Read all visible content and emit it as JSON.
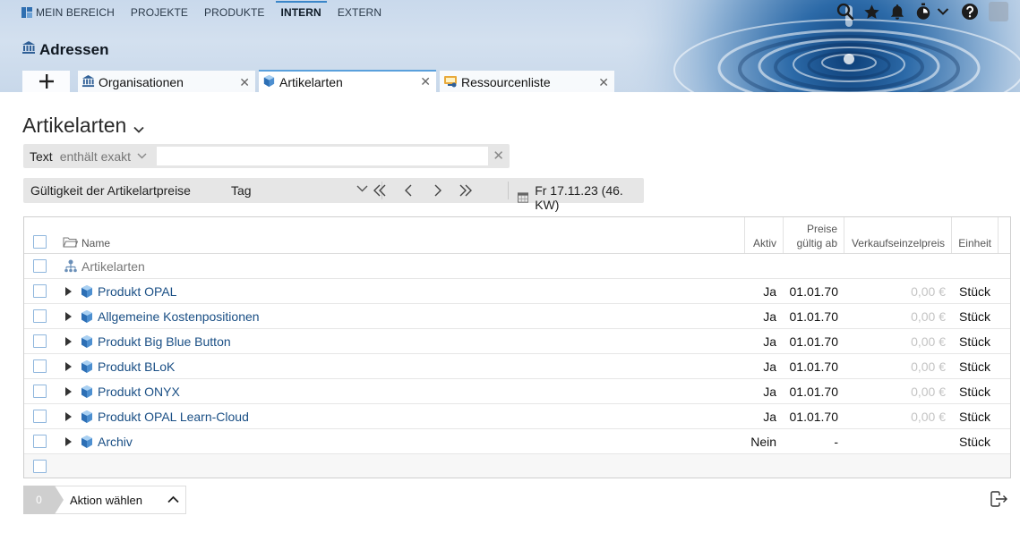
{
  "topnav": {
    "items": [
      {
        "label": "MEIN BEREICH"
      },
      {
        "label": "PROJEKTE"
      },
      {
        "label": "PRODUKTE"
      },
      {
        "label": "INTERN"
      },
      {
        "label": "EXTERN"
      }
    ],
    "active": "INTERN"
  },
  "tools": [
    "search-icon",
    "star-icon",
    "bell-icon",
    "stopwatch-icon",
    "chevron-down-icon",
    "help-icon",
    "user-avatar"
  ],
  "page": {
    "title": "Adressen"
  },
  "tabs": [
    {
      "label": "Organisationen",
      "icon": "building-icon"
    },
    {
      "label": "Artikelarten",
      "icon": "cube-icon",
      "active": true
    },
    {
      "label": "Ressourcenliste",
      "icon": "resource-icon"
    }
  ],
  "view": {
    "title": "Artikelarten"
  },
  "filter": {
    "field": "Text",
    "operator": "enthält exakt",
    "value": ""
  },
  "validity": {
    "label": "Gültigkeit der Artikelartpreise",
    "period": "Tag",
    "date": "Fr 17.11.23 (46. KW)"
  },
  "table": {
    "headers": {
      "name": "Name",
      "active": "Aktiv",
      "price_valid_1": "Preise",
      "price_valid_2": "gültig ab",
      "price": "Verkaufseinzelpreis",
      "unit": "Einheit"
    },
    "root": "Artikelarten",
    "rows": [
      {
        "name": "Produkt OPAL",
        "active": "Ja",
        "valid": "01.01.70",
        "price": "0,00 €",
        "unit": "Stück"
      },
      {
        "name": "Allgemeine Kostenpositionen",
        "active": "Ja",
        "valid": "01.01.70",
        "price": "0,00 €",
        "unit": "Stück"
      },
      {
        "name": "Produkt Big Blue Button",
        "active": "Ja",
        "valid": "01.01.70",
        "price": "0,00 €",
        "unit": "Stück"
      },
      {
        "name": "Produkt BLoK",
        "active": "Ja",
        "valid": "01.01.70",
        "price": "0,00 €",
        "unit": "Stück"
      },
      {
        "name": "Produkt ONYX",
        "active": "Ja",
        "valid": "01.01.70",
        "price": "0,00 €",
        "unit": "Stück"
      },
      {
        "name": "Produkt OPAL Learn-Cloud",
        "active": "Ja",
        "valid": "01.01.70",
        "price": "0,00 €",
        "unit": "Stück"
      },
      {
        "name": "Archiv",
        "active": "Nein",
        "valid": "-",
        "price": "",
        "unit": "Stück"
      }
    ]
  },
  "footer": {
    "count": "0",
    "action_label": "Aktion wählen"
  },
  "colors": {
    "link": "#1a4f85",
    "accent": "#5aa0dc",
    "checkbox": "#8fb6dd"
  }
}
